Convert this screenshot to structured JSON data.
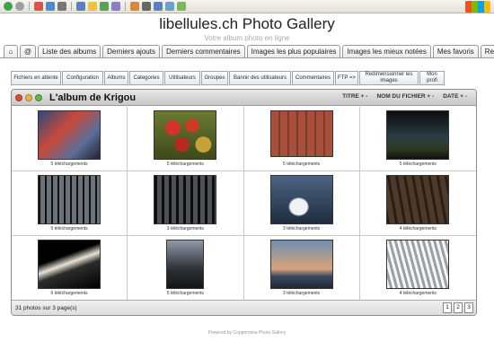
{
  "browser": {
    "icons": [
      "back-icon",
      "forward-icon",
      "stop-icon",
      "refresh-icon",
      "home-icon",
      "search-icon",
      "favorites-icon",
      "media-icon",
      "history-icon",
      "mail-icon",
      "print-icon",
      "edit-icon",
      "discuss-icon",
      "messenger-icon"
    ]
  },
  "site": {
    "title": "libellules.ch Photo Gallery",
    "subtitle": "Votre album photo en ligne"
  },
  "nav": {
    "tabs": [
      "@",
      "Liste des albums",
      "Derniers ajouts",
      "Derniers commentaires",
      "Images les plus populaires",
      "Images les mieux notées",
      "Mes favoris",
      "Re"
    ]
  },
  "admin": {
    "buttons": [
      {
        "label": "Fichiers en attente",
        "w": 56
      },
      {
        "label": "Configuration",
        "w": 46
      },
      {
        "label": "Albums",
        "w": 27
      },
      {
        "label": "Categories",
        "w": 38
      },
      {
        "label": "Utilisateurs",
        "w": 40
      },
      {
        "label": "Groupes",
        "w": 30
      },
      {
        "label": "Bannir des utilisateurs",
        "w": 69
      },
      {
        "label": "Commentaires",
        "w": 47
      },
      {
        "label": "FTP =>",
        "w": 26
      },
      {
        "label": "Redimensionner les images",
        "w": 66
      },
      {
        "label": "Mon profi",
        "w": 28
      }
    ]
  },
  "album": {
    "title": "L'album de Krigou",
    "sort": [
      "TITRE + -",
      "NOM DU FICHIER + -",
      "DATE + -"
    ],
    "photos": [
      {
        "caption": "5 téléchargements",
        "w": 70,
        "h": 55,
        "bg": "linear-gradient(135deg,#2d4a7a,#c94a3a 40%,#5b6f9a 70%,#223)"
      },
      {
        "caption": "5 téléchargements",
        "w": 70,
        "h": 55,
        "bg": "radial-gradient(circle at 30% 35%,#d2332b 14%,transparent 15%),radial-gradient(circle at 62% 30%,#cf3a22 13%,transparent 14%),radial-gradient(circle at 45% 70%,#b82a1f 15%,transparent 16%),radial-gradient(circle at 80% 70%,#c6a13a 13%,transparent 14%),linear-gradient(#6a7a32,#3e4a1a)"
      },
      {
        "caption": "5 téléchargements",
        "w": 70,
        "h": 52,
        "bg": "repeating-linear-gradient(90deg,#a84f3c 0 8px,#7a3b2e 8px 10px),linear-gradient(#c1c4c8,#6e2f25)"
      },
      {
        "caption": "5 téléchargements",
        "w": 70,
        "h": 55,
        "bg": "linear-gradient(#0b0d10,#2a3d44 55%,#2e3a22 80%,#0e0f0a)"
      },
      {
        "caption": "5 téléchargements",
        "w": 70,
        "h": 55,
        "bg": "repeating-linear-gradient(90deg,#111 0 2px,#6c727a 2px 7px),linear-gradient(#8b919a,#1c1e21)"
      },
      {
        "caption": "3 téléchargements",
        "w": 70,
        "h": 55,
        "bg": "repeating-linear-gradient(90deg,#0c0c0c 0 3px,#4d5156 3px 8px),linear-gradient(#6f747a,#111)"
      },
      {
        "caption": "3 téléchargements",
        "w": 70,
        "h": 55,
        "bg": "radial-gradient(ellipse at 45% 65%,#f1f2f3 18%,transparent 22%),linear-gradient(#4b6582,#1e2d3f)"
      },
      {
        "caption": "4 téléchargements",
        "w": 70,
        "h": 55,
        "bg": "repeating-linear-gradient(80deg,#2a1d14 0 3px,#4d3a2a 3px 9px),linear-gradient(#5a4b3a,#1b130c)"
      },
      {
        "caption": "6 téléchargements",
        "w": 70,
        "h": 55,
        "bg": "linear-gradient(160deg,#000 35%,#e7e2d3 48%,#2c2c2c 60%,#000)"
      },
      {
        "caption": "5 téléchargements",
        "w": 42,
        "h": 55,
        "bg": "linear-gradient(#8f9aa8,#2e3136 60%,#151515)"
      },
      {
        "caption": "3 téléchargements",
        "w": 70,
        "h": 55,
        "bg": "linear-gradient(#6f8fb3,#d9a17a 60%,#3c4b63 75%,#1e2733)"
      },
      {
        "caption": "4 téléchargements",
        "w": 70,
        "h": 55,
        "bg": "repeating-linear-gradient(75deg,#f5f6f7 0 3px,#9aa0a6 3px 6px),linear-gradient(#e8eaec,#777)"
      }
    ]
  },
  "footer": {
    "count": "31 photos sur 3 page(s)",
    "pages": [
      "1",
      "2",
      "3"
    ]
  },
  "powered": "Powered by Coppermine Photo Gallery"
}
